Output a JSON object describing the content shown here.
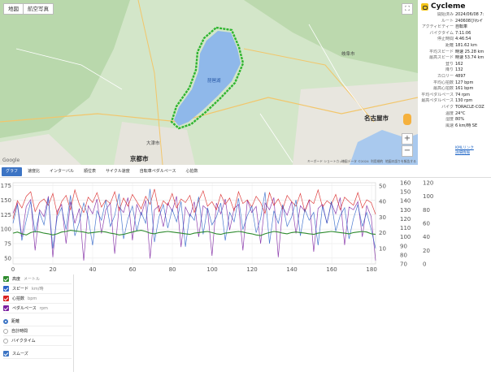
{
  "map": {
    "buttons": [
      "地図",
      "航空写真"
    ],
    "fullscreen_icon": "fullscreen-icon",
    "zoom_in": "+",
    "zoom_out": "−",
    "labels": {
      "kyoto": "京都市",
      "nagoya": "名古屋市",
      "otsu": "大津市",
      "gifu": "岐阜市",
      "lake": "琵琶湖"
    },
    "google_logo": "Google",
    "footer": [
      "キーボード ショートカット",
      "地図データ ©2024",
      "利用規約",
      "地図の誤りを報告する"
    ],
    "route_color": "#2fb52f",
    "water_color": "#8fb8ea"
  },
  "info": {
    "brand": "Cycleme",
    "rows": [
      {
        "k": "開始済み",
        "v": "2024/06/08 7:"
      },
      {
        "k": "ルート",
        "v": "240608びわイ"
      },
      {
        "k": "アクティビティー",
        "v": "自転車"
      },
      {
        "k": "バイクタイム",
        "v": "7:11:06"
      },
      {
        "k": "停止時間",
        "v": "4:46:54"
      },
      {
        "k": "距離",
        "v": "181.62 km"
      },
      {
        "k": "平均スピード",
        "v": "時速 25.28 km"
      },
      {
        "k": "最高スピード",
        "v": "時速 53.74 km"
      },
      {
        "k": "登り",
        "v": "162"
      },
      {
        "k": "降り",
        "v": "132"
      },
      {
        "k": "カロリー",
        "v": "4897"
      },
      {
        "k": "平均心拍数",
        "v": "127 bpm"
      },
      {
        "k": "最高心拍数",
        "v": "161 bpm"
      },
      {
        "k": "平均ペダルペース",
        "v": "74 rpm"
      },
      {
        "k": "最高ペダルペース",
        "v": "130 rpm"
      },
      {
        "k": "バイク",
        "v": "TORACLE-COZ"
      },
      {
        "k": "温度",
        "v": "24°C"
      },
      {
        "k": "湿度",
        "v": "80%"
      },
      {
        "k": "風速",
        "v": "6 km/時 SE"
      }
    ],
    "links": [
      "KMLリンク",
      "詳細情報"
    ]
  },
  "tabs": [
    "グラフ",
    "速度比",
    "インターバル",
    "順位表",
    "サイクル速度",
    "自転車ペダルペース",
    "心拍数"
  ],
  "controls": {
    "series": [
      {
        "label": "高度",
        "unit": "メートル",
        "color": "#2e8b2e"
      },
      {
        "label": "スピード",
        "unit": "km/時",
        "color": "#2a62c8"
      },
      {
        "label": "心拍数",
        "unit": "bpm",
        "color": "#d82020"
      },
      {
        "label": "ペダルペース",
        "unit": "rpm",
        "color": "#7a1fa0"
      }
    ],
    "xaxis_options": [
      {
        "label": "距離",
        "selected": true
      },
      {
        "label": "自計時間",
        "selected": false
      },
      {
        "label": "バイクタイム",
        "selected": false
      }
    ],
    "smooth": {
      "label": "スムーズ",
      "checked": true
    }
  },
  "chart_data": {
    "type": "line",
    "x_ticks": [
      0,
      20,
      40,
      60,
      80,
      100,
      120,
      140,
      160,
      180
    ],
    "xlim": [
      0,
      182
    ],
    "left_axis_ticks": [
      50,
      75,
      100,
      125,
      150,
      175
    ],
    "right_axis_ticks": [
      [
        10,
        20,
        30,
        40,
        50
      ],
      [
        70,
        80,
        90,
        100,
        110,
        120,
        130,
        140,
        150,
        160
      ],
      [
        0,
        20,
        40,
        60,
        80,
        100,
        120
      ]
    ],
    "grid": true,
    "series": [
      {
        "name": "高度",
        "color": "#2e8b2e",
        "axis": "left",
        "ylim": [
          40,
          180
        ],
        "values": [
          93,
          95,
          92,
          90,
          94,
          96,
          95,
          93,
          92,
          90,
          92,
          95,
          96,
          98,
          97,
          96,
          95,
          93,
          94,
          95,
          96,
          95,
          93,
          92,
          90,
          91,
          93,
          95,
          97,
          98,
          96,
          93,
          92,
          94,
          95,
          96,
          95,
          94,
          93,
          92,
          91,
          93,
          94,
          95,
          96,
          94,
          92,
          91,
          93,
          94,
          95,
          96,
          95,
          93,
          92,
          90,
          89,
          92,
          94,
          96,
          95,
          93,
          92,
          94,
          95,
          94,
          93,
          92,
          91,
          93,
          94,
          95,
          96,
          95,
          94,
          93,
          92,
          94,
          95,
          96,
          95,
          92,
          91
        ]
      },
      {
        "name": "スピード",
        "color": "#2a62c8",
        "axis": "right1",
        "ylim": [
          0,
          52
        ],
        "values": [
          26,
          38,
          15,
          28,
          40,
          20,
          33,
          25,
          42,
          10,
          30,
          36,
          22,
          44,
          18,
          27,
          39,
          30,
          12,
          34,
          28,
          41,
          24,
          31,
          45,
          16,
          29,
          37,
          21,
          33,
          26,
          48,
          14,
          30,
          38,
          23,
          35,
          27,
          40,
          11,
          32,
          28,
          43,
          19,
          36,
          25,
          30,
          39,
          15,
          33,
          27,
          42,
          22,
          31,
          37,
          20,
          29,
          46,
          13,
          34,
          26,
          38,
          24,
          30,
          41,
          18,
          35,
          28,
          33,
          12,
          37,
          26,
          40,
          21,
          31,
          36,
          16,
          29,
          38,
          24,
          33,
          22,
          10
        ]
      },
      {
        "name": "心拍数",
        "color": "#d82020",
        "axis": "right2",
        "ylim": [
          70,
          160
        ],
        "values": [
          120,
          140,
          132,
          145,
          150,
          128,
          138,
          142,
          135,
          148,
          125,
          139,
          146,
          130,
          152,
          136,
          127,
          144,
          138,
          149,
          133,
          141,
          137,
          150,
          129,
          143,
          134,
          147,
          139,
          131,
          145,
          136,
          153,
          128,
          140,
          135,
          148,
          132,
          142,
          138,
          146,
          127,
          140,
          151,
          134,
          139,
          130,
          147,
          136,
          143,
          129,
          150,
          137,
          141,
          133,
          145,
          138,
          126,
          149,
          135,
          142,
          131,
          146,
          139,
          134,
          148,
          128,
          141,
          137,
          152,
          133,
          140,
          136,
          147,
          130,
          144,
          139,
          135,
          149,
          132,
          141,
          138,
          125
        ]
      },
      {
        "name": "ペダルペース",
        "color": "#7a1fa0",
        "axis": "right3",
        "ylim": [
          0,
          120
        ],
        "values": [
          75,
          90,
          40,
          85,
          95,
          20,
          80,
          70,
          100,
          10,
          78,
          88,
          30,
          92,
          60,
          82,
          5,
          86,
          74,
          96,
          45,
          80,
          90,
          15,
          84,
          76,
          98,
          35,
          88,
          72,
          94,
          8,
          80,
          86,
          55,
          90,
          78,
          100,
          25,
          84,
          70,
          92,
          40,
          86,
          80,
          12,
          90,
          74,
          96,
          50,
          82,
          88,
          20,
          94,
          76,
          85,
          30,
          90,
          80,
          98,
          10,
          84,
          72,
          92,
          45,
          86,
          78,
          95,
          18,
          82,
          88,
          60,
          90,
          74,
          98,
          28,
          84,
          80,
          92,
          40,
          86,
          70,
          5
        ]
      }
    ]
  }
}
